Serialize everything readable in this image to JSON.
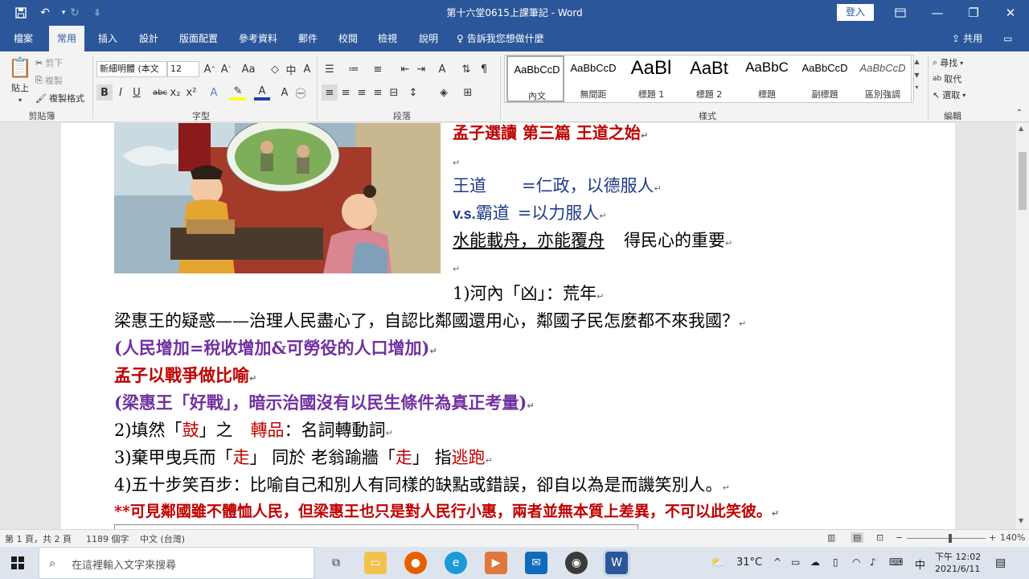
{
  "titlebar": {
    "title": "第十六堂0615上課筆記 - Word",
    "signin": "登入",
    "qa_save_icon": "save-icon",
    "qa_undo_icon": "undo-icon",
    "qa_redo_icon": "redo-icon",
    "qa_customize_icon": "customize-icon",
    "ribbon_display_icon": "ribbon-display-icon",
    "minimize_glyph": "—",
    "maximize_glyph": "❐",
    "close_glyph": "✕"
  },
  "tabs": [
    "檔案",
    "常用",
    "插入",
    "設計",
    "版面配置",
    "參考資料",
    "郵件",
    "校閱",
    "檢視",
    "說明"
  ],
  "tell_me": "告訴我您想做什麼",
  "share": "共用",
  "ribbon": {
    "clipboard": {
      "paste": "貼上",
      "cut": "剪下",
      "copy": "複製",
      "format_painter": "複製格式",
      "label": "剪貼簿"
    },
    "font": {
      "name": "新細明體 (本文",
      "size": "12",
      "label": "字型"
    },
    "paragraph": {
      "label": "段落"
    },
    "styles": {
      "label": "樣式",
      "items": [
        {
          "sample": "AaBbCcD",
          "name": "內文"
        },
        {
          "sample": "AaBbCcD",
          "name": "無間距"
        },
        {
          "sample": "AaBl",
          "name": "標題 1"
        },
        {
          "sample": "AaBt",
          "name": "標題 2"
        },
        {
          "sample": "AaBbC",
          "name": "標題"
        },
        {
          "sample": "AaBbCcD",
          "name": "副標題"
        },
        {
          "sample": "AaBbCcD",
          "name": "區別強調"
        }
      ]
    },
    "editing": {
      "find": "尋找",
      "replace": "取代",
      "select": "選取",
      "label": "編輯"
    }
  },
  "document": {
    "title_line": "孟子選讀 第三篇 王道之始",
    "wangdao_a": "王道",
    "wangdao_b": "=仁政，以德服人",
    "vs": "v.s.",
    "badao_a": "霸道",
    "badao_b": "=以力服人",
    "water_a": "水能載舟，亦能覆舟",
    "water_b": "得民心的重要",
    "item1": "1)河內「凶」：荒年",
    "question": "梁惠王的疑惑——治理人民盡心了，自認比鄰國還用心，鄰國子民怎麼都不來我國？",
    "people": "(人民增加=稅收增加&可勞役的人口增加)",
    "mencius": "孟子以戰爭做比喻",
    "liang": "(梁惠王「好戰」，暗示治國沒有以民生條件為真正考量)",
    "item2_a": "2)填然「",
    "item2_b": "鼓",
    "item2_c": "」之",
    "item2_d": "轉品",
    "item2_e": "：名詞轉動詞",
    "item3_a": "3)棄甲曳兵而「",
    "item3_b": "走",
    "item3_c": "」 同於 老翁踰牆「",
    "item3_d": "走",
    "item3_e": "」 指",
    "item3_f": "逃跑",
    "item4": "4)五十步笑百步：比喻自己和別人有同樣的缺點或錯誤，卻自以為是而譏笑別人。",
    "conclusion": "**可見鄰國雖不體恤人民，但梁惠王也只是對人民行小惠，兩者並無本質上差異，不可以此笑彼。",
    "para_mark": "↵"
  },
  "status": {
    "page": "第 1 頁，共 2 頁",
    "words": "1189 個字",
    "lang": "中文 (台灣)",
    "zoom": "140%",
    "zoom_level": 0.55
  },
  "taskbar": {
    "search_placeholder": "在這裡輸入文字來搜尋",
    "temp": "31°C",
    "ime": "中",
    "time": "下午 12:02",
    "date": "2021/6/11"
  },
  "colors": {
    "brand": "#2b579a",
    "red": "#c00000",
    "purple": "#7030a0",
    "blue": "#1f3a8a"
  }
}
